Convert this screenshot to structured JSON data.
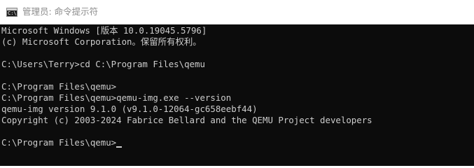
{
  "window": {
    "title": "管理员: 命令提示符",
    "icon_label": "C:\\"
  },
  "console": {
    "lines": [
      "Microsoft Windows [版本 10.0.19045.5796]",
      "(c) Microsoft Corporation。保留所有权利。",
      "",
      "C:\\Users\\Terry>cd C:\\Program Files\\qemu",
      "",
      "C:\\Program Files\\qemu>",
      "C:\\Program Files\\qemu>qemu-img.exe --version",
      "qemu-img version 9.1.0 (v9.1.0-12064-gc658eebf44)",
      "Copyright (c) 2003-2024 Fabrice Bellard and the QEMU Project developers",
      "",
      "C:\\Program Files\\qemu>"
    ]
  },
  "colors": {
    "console_background": "#0c0c0c",
    "console_text": "#cccccc",
    "titlebar_background": "#ffffff",
    "title_text": "#8c8c8c"
  },
  "icons": {
    "app": "command-prompt-icon"
  }
}
